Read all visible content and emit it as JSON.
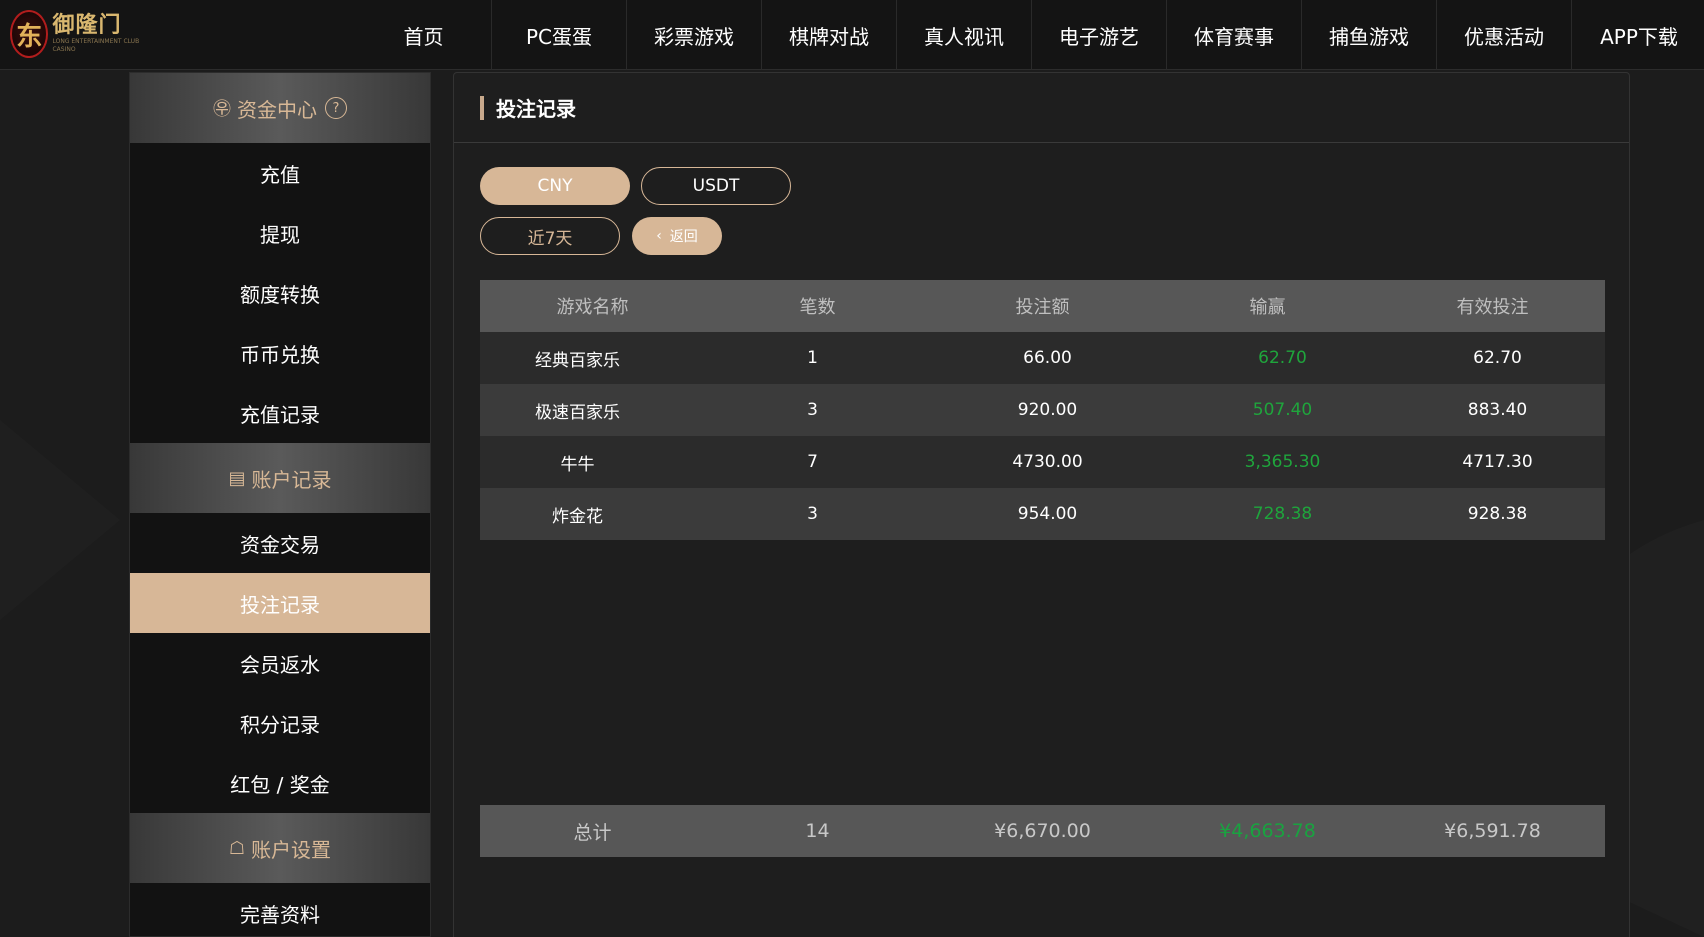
{
  "brand": {
    "name": "御隆门",
    "mark": "东",
    "tagline": "LONG ENTERTAINMENT CLUB CASINO"
  },
  "nav": [
    {
      "label": "首页"
    },
    {
      "label": "PC蛋蛋"
    },
    {
      "label": "彩票游戏"
    },
    {
      "label": "棋牌对战"
    },
    {
      "label": "真人视讯"
    },
    {
      "label": "电子游艺"
    },
    {
      "label": "体育赛事"
    },
    {
      "label": "捕鱼游戏"
    },
    {
      "label": "优惠活动"
    },
    {
      "label": "APP下载"
    }
  ],
  "sidebar": {
    "sections": [
      {
        "title": "资金中心",
        "icon": "yen-circle-icon",
        "icon_glyph": "㉾",
        "help": "?",
        "items": [
          {
            "label": "充值"
          },
          {
            "label": "提现"
          },
          {
            "label": "额度转换"
          },
          {
            "label": "币币兑换"
          },
          {
            "label": "充值记录"
          }
        ]
      },
      {
        "title": "账户记录",
        "icon": "document-icon",
        "icon_glyph": "▤",
        "items": [
          {
            "label": "资金交易"
          },
          {
            "label": "投注记录",
            "active": true
          },
          {
            "label": "会员返水"
          },
          {
            "label": "积分记录"
          },
          {
            "label": "红包 / 奖金"
          }
        ]
      },
      {
        "title": "账户设置",
        "icon": "user-card-icon",
        "icon_glyph": "☖",
        "items": [
          {
            "label": "完善资料"
          }
        ]
      }
    ]
  },
  "main": {
    "title": "投注记录",
    "currency_tabs": [
      {
        "label": "CNY",
        "selected": true
      },
      {
        "label": "USDT",
        "selected": false
      }
    ],
    "date_filter": "近7天",
    "back_label": "返回",
    "back_icon": "chevron-left-icon",
    "table": {
      "headers": [
        "游戏名称",
        "笔数",
        "投注额",
        "输赢",
        "有效投注"
      ],
      "rows": [
        [
          "经典百家乐",
          "1",
          "66.00",
          "62.70",
          "62.70"
        ],
        [
          "极速百家乐",
          "3",
          "920.00",
          "507.40",
          "883.40"
        ],
        [
          "牛牛",
          "7",
          "4730.00",
          "3,365.30",
          "4717.30"
        ],
        [
          "炸金花",
          "3",
          "954.00",
          "728.38",
          "928.38"
        ]
      ],
      "total": [
        "总计",
        "14",
        "¥6,670.00",
        "¥4,663.78",
        "¥6,591.78"
      ]
    }
  },
  "colors": {
    "accent": "#d7b797",
    "win_green": "#1fa53c",
    "header_bg": "#141414",
    "table_header_bg": "#575757"
  }
}
